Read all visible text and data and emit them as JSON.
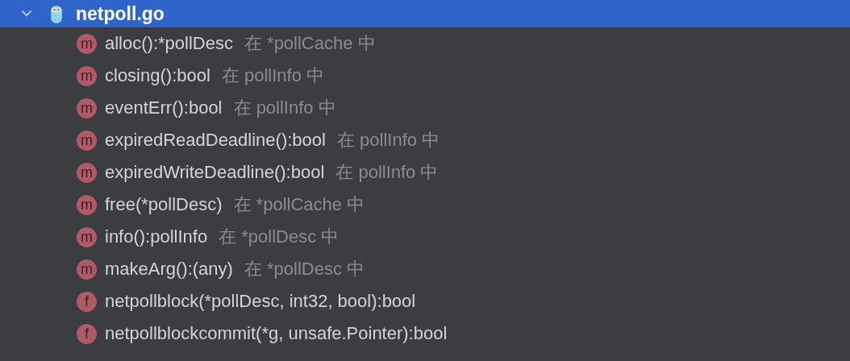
{
  "file": {
    "name": "netpoll.go",
    "expanded": true,
    "selected": true
  },
  "items": [
    {
      "badge": "m",
      "name": "alloc():*pollDesc",
      "location": "在 *pollCache 中"
    },
    {
      "badge": "m",
      "name": "closing():bool",
      "location": "在 pollInfo 中"
    },
    {
      "badge": "m",
      "name": "eventErr():bool",
      "location": "在 pollInfo 中"
    },
    {
      "badge": "m",
      "name": "expiredReadDeadline():bool",
      "location": "在 pollInfo 中"
    },
    {
      "badge": "m",
      "name": "expiredWriteDeadline():bool",
      "location": "在 pollInfo 中"
    },
    {
      "badge": "m",
      "name": "free(*pollDesc)",
      "location": "在 *pollCache 中"
    },
    {
      "badge": "m",
      "name": "info():pollInfo",
      "location": "在 *pollDesc 中"
    },
    {
      "badge": "m",
      "name": "makeArg():(any)",
      "location": "在 *pollDesc 中"
    },
    {
      "badge": "f",
      "name": "netpollblock(*pollDesc, int32, bool):bool"
    },
    {
      "badge": "f",
      "name": "netpollblockcommit(*g, unsafe.Pointer):bool"
    }
  ]
}
